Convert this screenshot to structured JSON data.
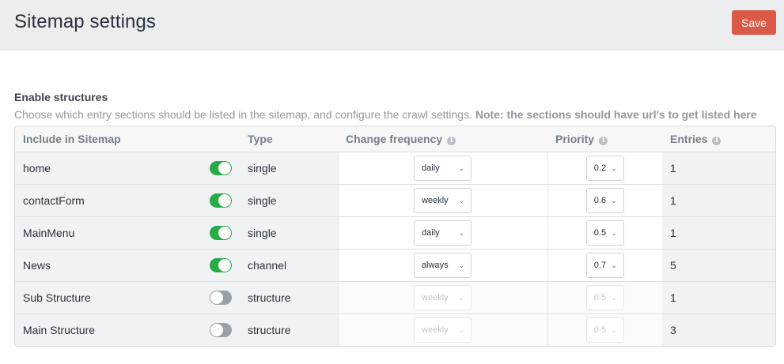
{
  "header": {
    "title": "Sitemap settings",
    "save_label": "Save"
  },
  "field": {
    "label": "Enable structures",
    "instructions": "Choose which entry sections should be listed in the sitemap, and configure the crawl settings.",
    "note": "Note: the sections should have url's to get listed here"
  },
  "table": {
    "columns": {
      "include": "Include in Sitemap",
      "type": "Type",
      "frequency": "Change frequency",
      "priority": "Priority",
      "entries": "Entries"
    },
    "info_glyph": "i",
    "chevron_glyph": "⌄",
    "rows": [
      {
        "name": "home",
        "enabled": true,
        "type": "single",
        "frequency": "daily",
        "priority": "0.2",
        "entries": "1"
      },
      {
        "name": "contactForm",
        "enabled": true,
        "type": "single",
        "frequency": "weekly",
        "priority": "0.6",
        "entries": "1"
      },
      {
        "name": "MainMenu",
        "enabled": true,
        "type": "single",
        "frequency": "daily",
        "priority": "0.5",
        "entries": "1"
      },
      {
        "name": "News",
        "enabled": true,
        "type": "channel",
        "frequency": "always",
        "priority": "0.7",
        "entries": "5"
      },
      {
        "name": "Sub Structure",
        "enabled": false,
        "type": "structure",
        "frequency": "weekly",
        "priority": "0.5",
        "entries": "1"
      },
      {
        "name": "Main Structure",
        "enabled": false,
        "type": "structure",
        "frequency": "weekly",
        "priority": "0.5",
        "entries": "3"
      }
    ]
  },
  "colors": {
    "save": "#da5a47",
    "toggle_on": "#27ab45",
    "toggle_off": "#9aa0a6",
    "header_bg": "#ebedef"
  }
}
